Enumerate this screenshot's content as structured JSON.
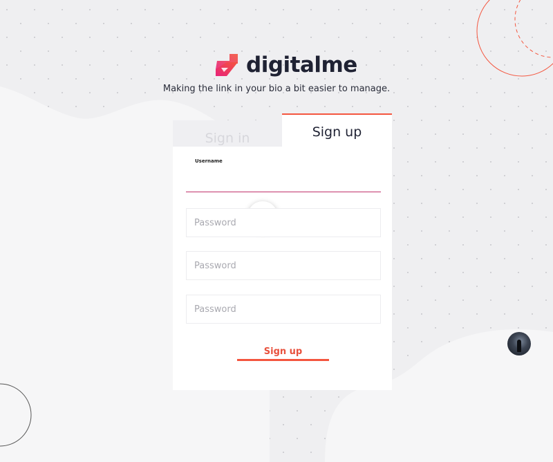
{
  "brand": {
    "name": "digitalme",
    "tagline": "Making the link in your bio a bit easier to manage.",
    "accent": "#f4553e",
    "logo_gradient": [
      "#e8237a",
      "#f4553e"
    ]
  },
  "tabs": {
    "signin": "Sign in",
    "signup": "Sign up",
    "active": "signup"
  },
  "form": {
    "username_label": "Username",
    "username_value": "",
    "password_placeholder_1": "Password",
    "password_placeholder_2": "Password",
    "password_placeholder_3": "Password",
    "submit_label": "Sign up"
  },
  "icons": {
    "logo": "digitalme-logo-icon",
    "avatar": "user-avatar"
  }
}
